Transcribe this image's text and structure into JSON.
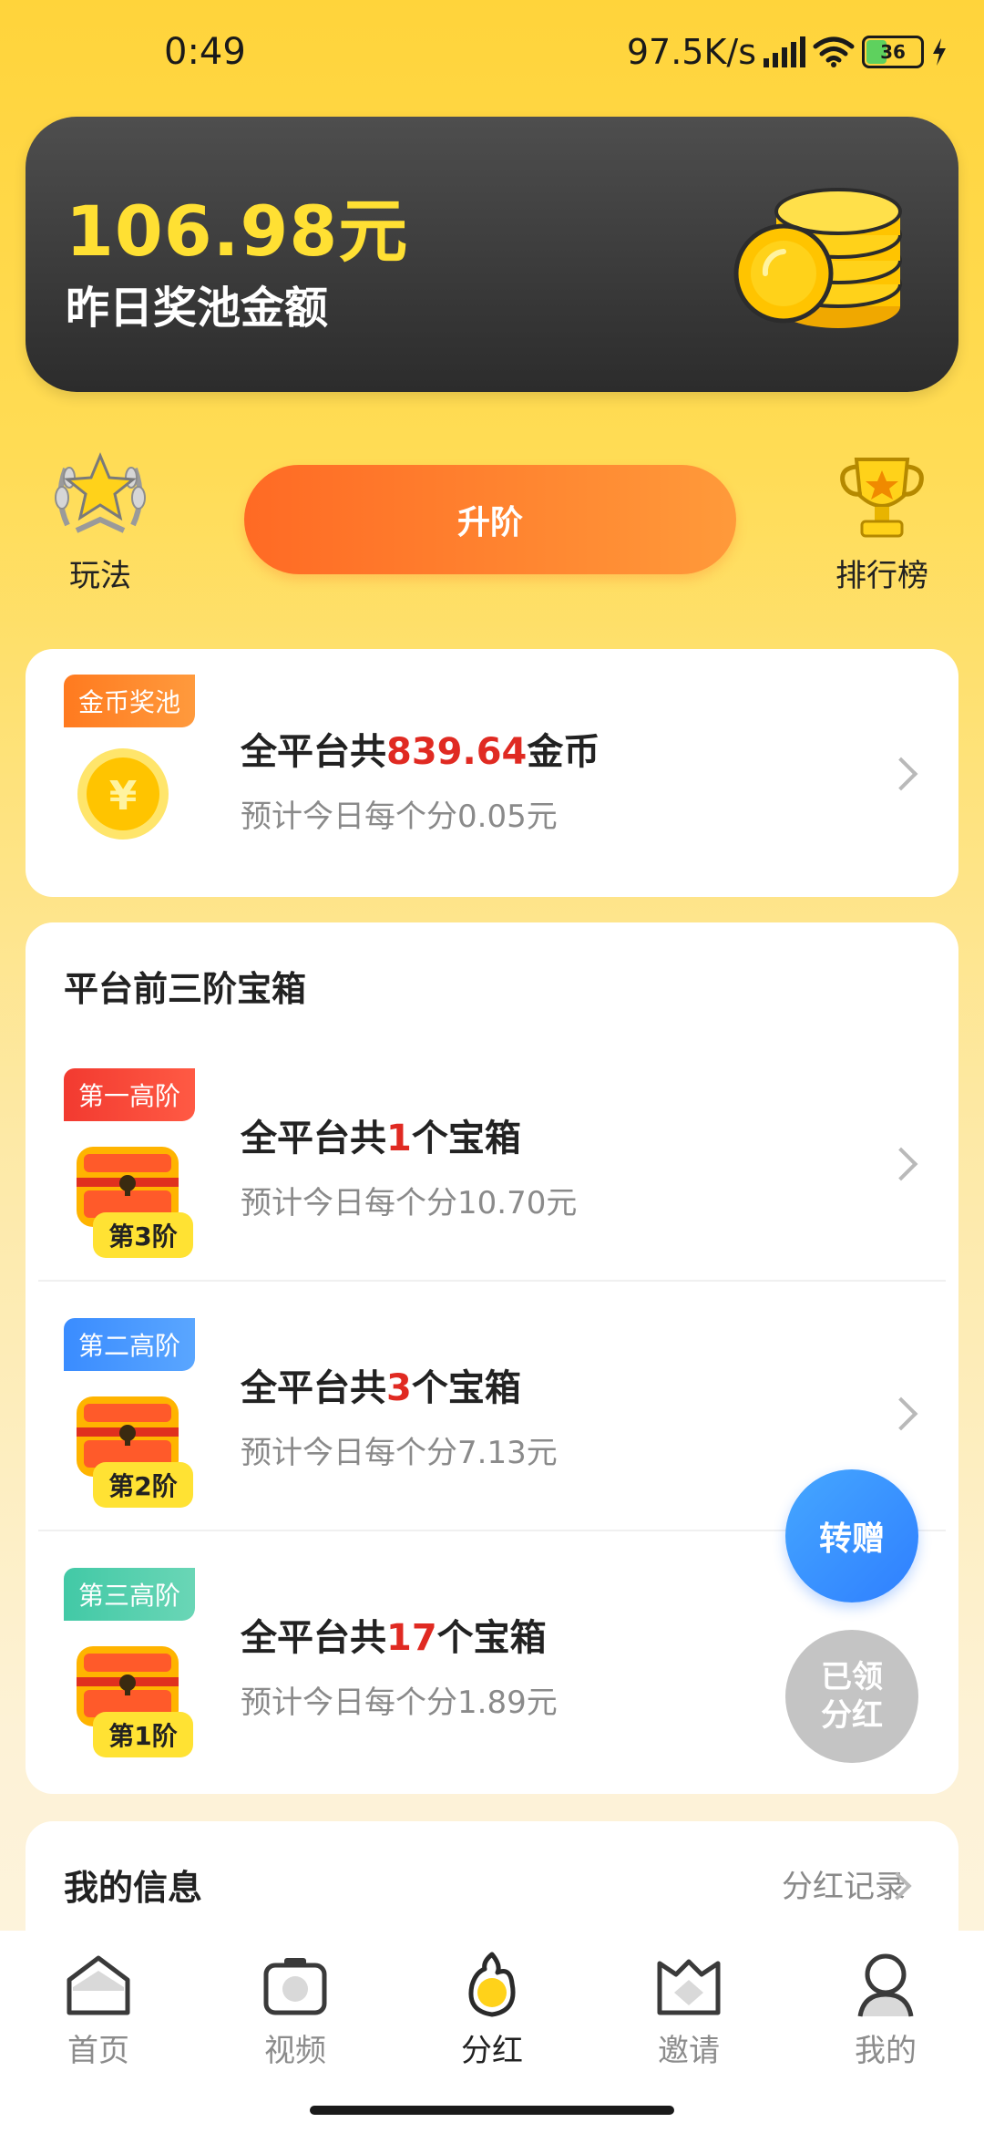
{
  "status_bar": {
    "time": "0:49",
    "network_speed": "97.5K/s",
    "battery": "36"
  },
  "pool": {
    "amount": "106.98元",
    "label": "昨日奖池金额"
  },
  "quick_actions": {
    "rules_label": "玩法",
    "upgrade_label": "升阶",
    "ranking_label": "排行榜"
  },
  "coin_pool": {
    "tag": "金币奖池",
    "title_prefix": "全平台共",
    "title_value": "839.64",
    "title_suffix": "金币",
    "subtitle": "预计今日每个分0.05元"
  },
  "chests_section": {
    "title": "平台前三阶宝箱",
    "rows": [
      {
        "tag": "第一高阶",
        "badge": "第3阶",
        "title_prefix": "全平台共",
        "count": "1",
        "title_suffix": "个宝箱",
        "subtitle": "预计今日每个分10.70元"
      },
      {
        "tag": "第二高阶",
        "badge": "第2阶",
        "title_prefix": "全平台共",
        "count": "3",
        "title_suffix": "个宝箱",
        "subtitle": "预计今日每个分7.13元"
      },
      {
        "tag": "第三高阶",
        "badge": "第1阶",
        "title_prefix": "全平台共",
        "count": "17",
        "title_suffix": "个宝箱",
        "subtitle": "预计今日每个分1.89元"
      }
    ]
  },
  "floating": {
    "transfer_label": "转赠",
    "claimed_line1": "已领",
    "claimed_line2": "分红"
  },
  "my_info": {
    "title": "我的信息",
    "records_link": "分红记录"
  },
  "tabs": [
    {
      "label": "首页",
      "icon": "home-icon"
    },
    {
      "label": "视频",
      "icon": "camera-icon"
    },
    {
      "label": "分红",
      "icon": "dividend-flame-icon",
      "active": true
    },
    {
      "label": "邀请",
      "icon": "invite-envelope-icon"
    },
    {
      "label": "我的",
      "icon": "profile-icon"
    }
  ],
  "colors": {
    "accent_yellow": "#ffd43b",
    "highlight_red": "#e02a22",
    "upgrade_orange": "#ff7a2b",
    "transfer_blue": "#3a8cff"
  }
}
